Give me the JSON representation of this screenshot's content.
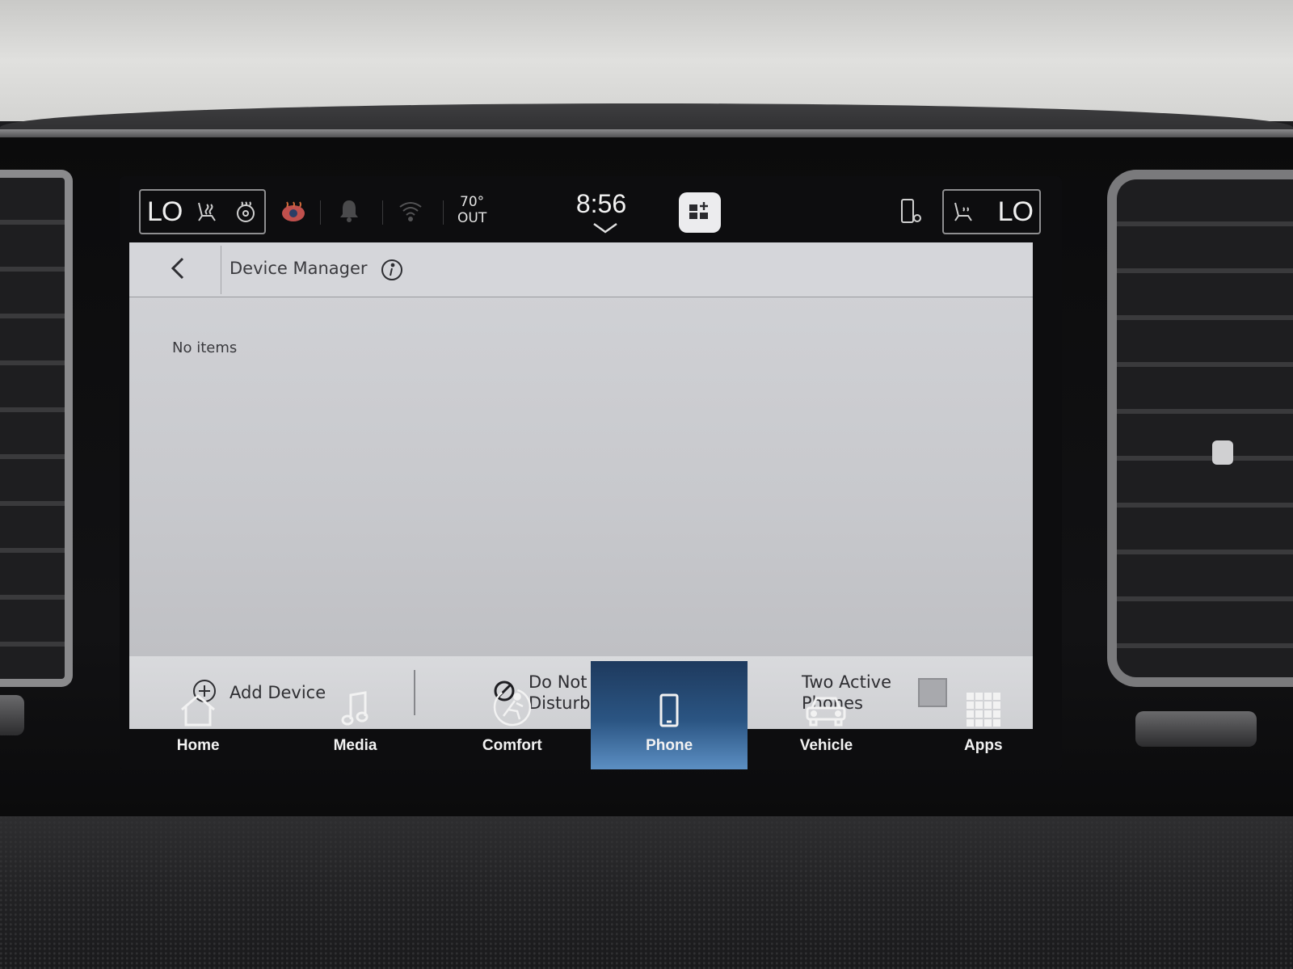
{
  "status_bar": {
    "driver_temp": "LO",
    "passenger_temp": "LO",
    "outside_temp": "70°",
    "outside_label": "OUT",
    "clock": "8:56"
  },
  "page": {
    "title": "Device Manager",
    "empty_message": "No items"
  },
  "actions": {
    "add_device": "Add Device",
    "do_not_disturb_line1": "Do Not",
    "do_not_disturb_line2": "Disturb",
    "two_active_phones_line1": "Two Active",
    "two_active_phones_line2": "Phones"
  },
  "nav": {
    "items": [
      {
        "label": "Home",
        "icon": "home-icon"
      },
      {
        "label": "Media",
        "icon": "music-note-icon"
      },
      {
        "label": "Comfort",
        "icon": "seat-comfort-icon"
      },
      {
        "label": "Phone",
        "icon": "phone-icon"
      },
      {
        "label": "Vehicle",
        "icon": "car-icon"
      },
      {
        "label": "Apps",
        "icon": "apps-grid-icon"
      }
    ],
    "active": "Phone"
  },
  "colors": {
    "nav_active": "#2b5583",
    "panel_bg": "#c8c9cd"
  }
}
